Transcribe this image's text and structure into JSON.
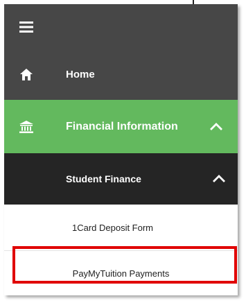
{
  "menu": {
    "toggle_icon": "hamburger-menu-icon",
    "items": [
      {
        "label": "Home",
        "icon": "home-icon"
      },
      {
        "label": "Financial Information",
        "icon": "bank-icon",
        "expanded": true,
        "active_color": "#63b95e"
      },
      {
        "label": "Student Finance",
        "expanded": true
      }
    ],
    "subitems": [
      {
        "label": "1Card Deposit Form"
      },
      {
        "label": "PayMyTuition Payments",
        "highlighted": true
      }
    ]
  },
  "colors": {
    "menu_bg": "#474747",
    "active_bg": "#63b95e",
    "submenu_header_bg": "#252525",
    "highlight_border": "#e00000"
  }
}
